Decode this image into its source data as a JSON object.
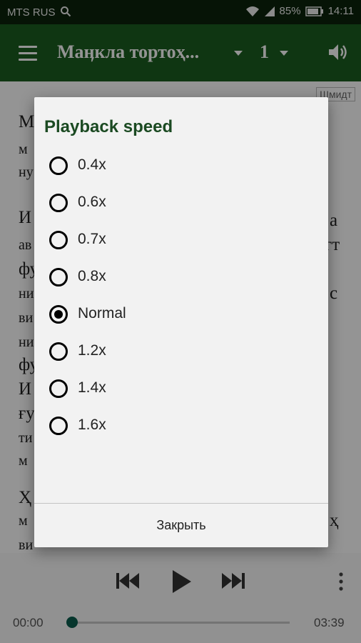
{
  "status_bar": {
    "carrier": "MTS RUS",
    "battery": "85%",
    "time": "14:11"
  },
  "app_bar": {
    "book_title": "Маӊкла тортоҳ...",
    "chapter": "1"
  },
  "content": {
    "author_tag": "Шмидт",
    "lines": [
      "М",
      "м",
      "ну",
      "И",
      "ав",
      "фу",
      "ни",
      "ви",
      "ни",
      "фу",
      "И",
      "ғу",
      "ти",
      "м",
      "Ҳ",
      "м",
      "ви"
    ],
    "right_fragments": [
      "а",
      "гт",
      "с",
      "ҳ"
    ]
  },
  "dialog": {
    "title": "Playback speed",
    "options": [
      {
        "label": "0.4x",
        "selected": false
      },
      {
        "label": "0.6x",
        "selected": false
      },
      {
        "label": "0.7x",
        "selected": false
      },
      {
        "label": "0.8x",
        "selected": false
      },
      {
        "label": "Normal",
        "selected": true
      },
      {
        "label": "1.2x",
        "selected": false
      },
      {
        "label": "1.4x",
        "selected": false
      },
      {
        "label": "1.6x",
        "selected": false
      }
    ],
    "close_label": "Закрыть"
  },
  "player": {
    "elapsed": "00:00",
    "duration": "03:39",
    "progress": 0
  },
  "colors": {
    "app_bar": "#1b5e20",
    "status_bar": "#0b240b",
    "dialog_title": "#1b4a22",
    "seek_thumb": "#0b5e4f"
  },
  "icons": [
    "search-icon",
    "wifi-icon",
    "signal-icon",
    "battery-icon",
    "menu-icon",
    "dropdown-caret-icon",
    "volume-icon",
    "skip-previous-icon",
    "play-icon",
    "skip-next-icon",
    "more-vert-icon"
  ]
}
